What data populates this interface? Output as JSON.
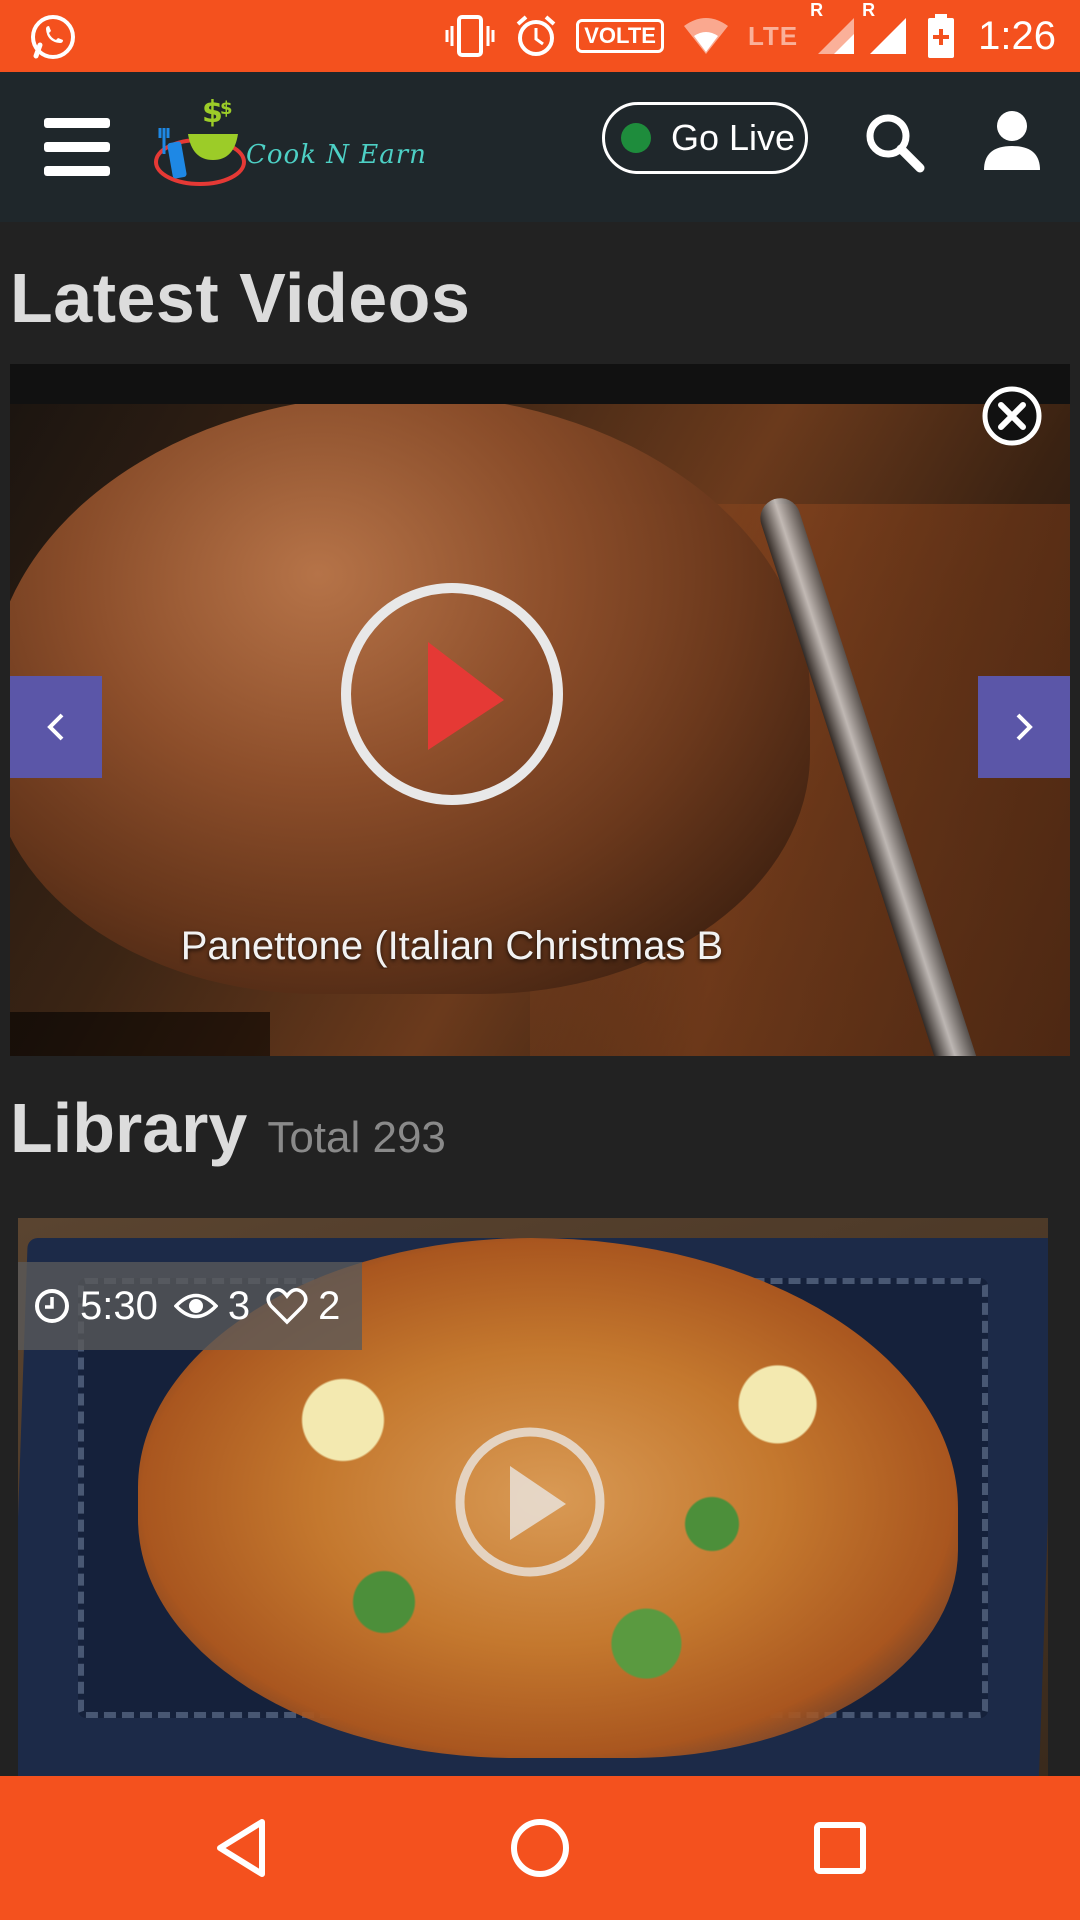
{
  "status_bar": {
    "network_label": "VOLTE",
    "lte_label": "LTE",
    "roaming_1": "R",
    "roaming_2": "R",
    "time": "1:26"
  },
  "header": {
    "app_name": "Cook N Earn",
    "go_live_label": "Go Live",
    "icons": [
      "menu-icon",
      "search-icon",
      "user-icon"
    ]
  },
  "latest": {
    "title": "Latest Videos",
    "slide_title": "Panettone (Italian Christmas B"
  },
  "library": {
    "title": "Library",
    "total": "Total 293",
    "card": {
      "duration": "5:30",
      "views": "3",
      "likes": "2"
    }
  },
  "colors": {
    "accent_orange": "#f4511e",
    "header_bg": "#1f272b",
    "nav_purple": "#5b56a8",
    "live_green": "#1e8c3c",
    "play_red": "#e53935"
  }
}
